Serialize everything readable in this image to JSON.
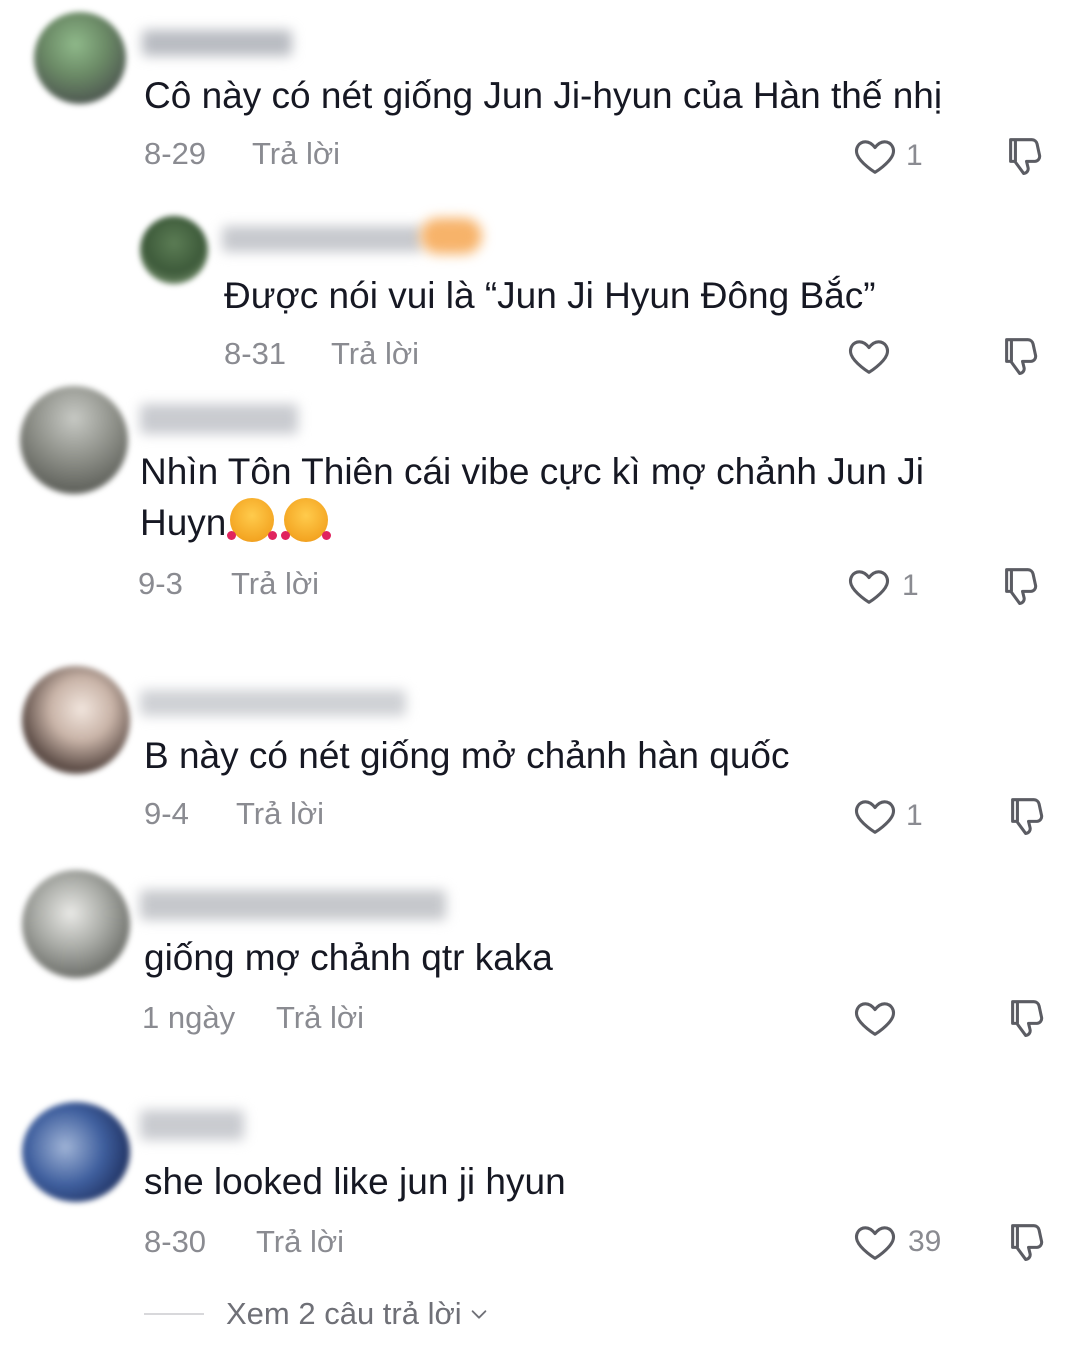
{
  "colors": {
    "background": "#ffffff",
    "text": "#161823",
    "meta": "#8a8b91",
    "icon_stroke": "#5b5c63"
  },
  "comments": [
    {
      "text": "Cô này có nét giống Jun Ji-hyun của Hàn thế nhị",
      "date": "8-29",
      "reply_label": "Trả lời",
      "likes": "1",
      "like_icon": "heart-icon",
      "dislike_icon": "thumbs-down-icon"
    },
    {
      "text": "Được nói vui là “Jun Ji Hyun Đông Bắc”",
      "date": "8-31",
      "reply_label": "Trả lời",
      "likes": "",
      "like_icon": "heart-icon",
      "dislike_icon": "thumbs-down-icon"
    },
    {
      "text_line1": "Nhìn Tôn Thiên cái vibe cực kì mợ chảnh Jun Ji",
      "text_line2": "Huyn",
      "emojis": [
        "smiling-face-with-hearts-emoji",
        "smiling-face-with-hearts-emoji"
      ],
      "date": "9-3",
      "reply_label": "Trả lời",
      "likes": "1",
      "like_icon": "heart-icon",
      "dislike_icon": "thumbs-down-icon"
    },
    {
      "text": "B này có nét giống mở chảnh hàn quốc",
      "date": "9-4",
      "reply_label": "Trả lời",
      "likes": "1",
      "like_icon": "heart-icon",
      "dislike_icon": "thumbs-down-icon"
    },
    {
      "text": "giống mợ chảnh qtr kaka",
      "date": "1 ngày",
      "reply_label": "Trả lời",
      "likes": "",
      "like_icon": "heart-icon",
      "dislike_icon": "thumbs-down-icon"
    },
    {
      "text": "she looked like jun ji hyun",
      "date": "8-30",
      "reply_label": "Trả lời",
      "likes": "39",
      "like_icon": "heart-icon",
      "dislike_icon": "thumbs-down-icon"
    }
  ],
  "view_replies": {
    "label": "Xem 2 câu trả lời",
    "icon": "chevron-down-icon"
  }
}
